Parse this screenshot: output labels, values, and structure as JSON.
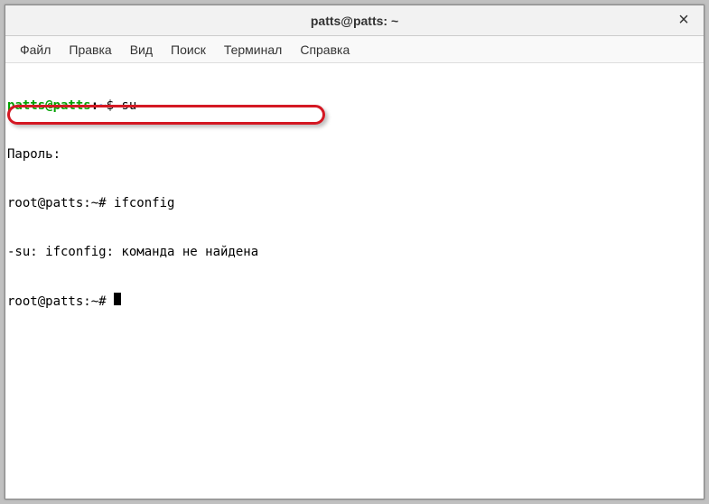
{
  "window": {
    "title": "patts@patts: ~"
  },
  "menubar": {
    "items": [
      "Файл",
      "Правка",
      "Вид",
      "Поиск",
      "Терминал",
      "Справка"
    ]
  },
  "terminal": {
    "line1": {
      "user": "patts@patts",
      "colon": ":",
      "path": "~",
      "symbol": "$ ",
      "command": "su -"
    },
    "line2": "Пароль:",
    "line3": {
      "prompt": "root@patts:~# ",
      "command": "ifconfig"
    },
    "line4": "-su: ifconfig: команда не найдена",
    "line5": {
      "prompt": "root@patts:~# "
    }
  }
}
